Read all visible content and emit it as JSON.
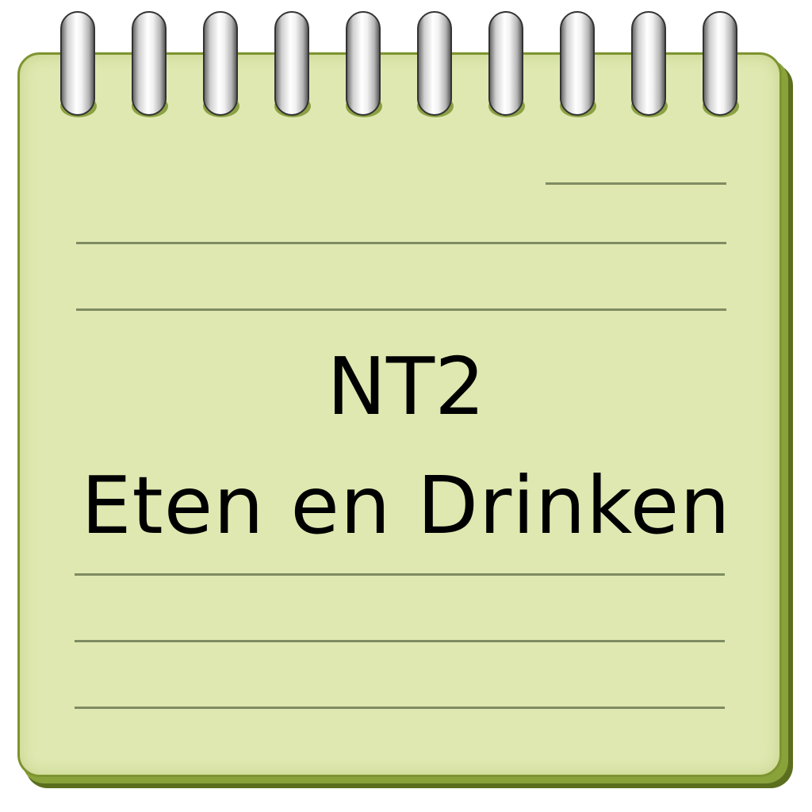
{
  "notepad": {
    "title_line_1": "NT2",
    "title_line_2": "Eten en Drinken",
    "paper_color": "#dfe8b0",
    "border_color": "#7d9430",
    "ring_count": 10
  }
}
